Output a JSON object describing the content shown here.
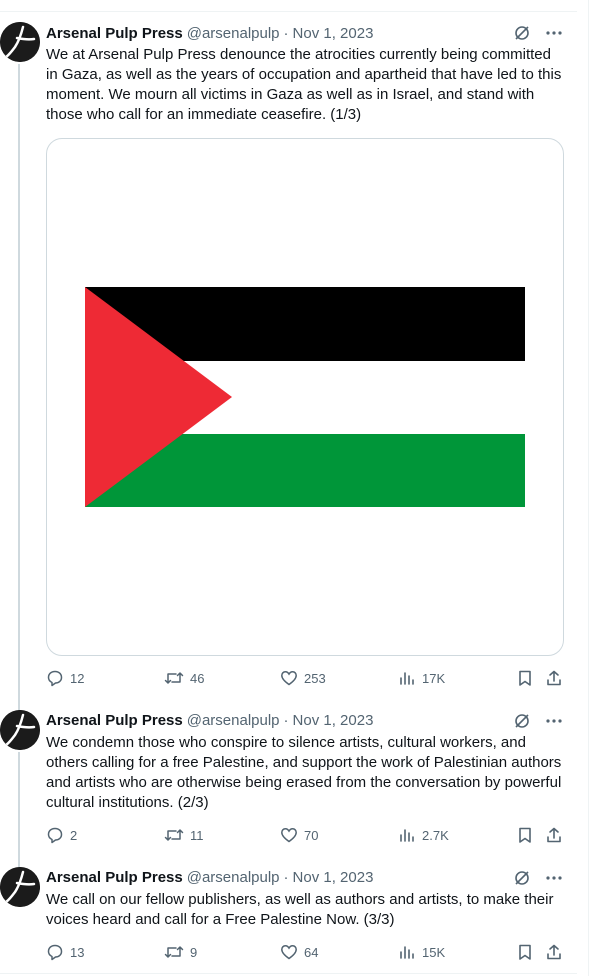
{
  "tweets": [
    {
      "name": "Arsenal Pulp Press",
      "handle": "@arsenalpulp",
      "separator": "·",
      "date": "Nov 1, 2023",
      "text": "We at Arsenal Pulp Press denounce the atrocities currently being committed in Gaza, as well as the years of occupation and apartheid that have led to this moment. We mourn all victims in Gaza as well as in Israel, and stand with those who call for an immediate ceasefire. (1/3)",
      "media": {
        "type": "image",
        "subject": "flag-of-palestine",
        "colors": {
          "black": "#000000",
          "white": "#ffffff",
          "green": "#009639",
          "red": "#ee2a35"
        }
      },
      "replies": "12",
      "reposts": "46",
      "likes": "253",
      "views": "17K"
    },
    {
      "name": "Arsenal Pulp Press",
      "handle": "@arsenalpulp",
      "separator": "·",
      "date": "Nov 1, 2023",
      "text": "We condemn those who conspire to silence artists, cultural workers, and others calling for a free Palestine, and support the work of Palestinian authors and artists who are otherwise being erased from the conversation by powerful cultural institutions. (2/3)",
      "replies": "2",
      "reposts": "11",
      "likes": "70",
      "views": "2.7K"
    },
    {
      "name": "Arsenal Pulp Press",
      "handle": "@arsenalpulp",
      "separator": "·",
      "date": "Nov 1, 2023",
      "text": "We call on our fellow publishers, as well as authors and artists, to make their voices heard and call for a Free Palestine Now. (3/3)",
      "replies": "13",
      "reposts": "9",
      "likes": "64",
      "views": "15K"
    }
  ],
  "icons": [
    "grok-icon",
    "more-icon",
    "reply-icon",
    "repost-icon",
    "like-icon",
    "views-icon",
    "bookmark-icon",
    "share-icon"
  ],
  "theme": {
    "text": "#0f1419",
    "secondary": "#536471",
    "border": "#cfd9de",
    "divider": "#eff3f4"
  }
}
